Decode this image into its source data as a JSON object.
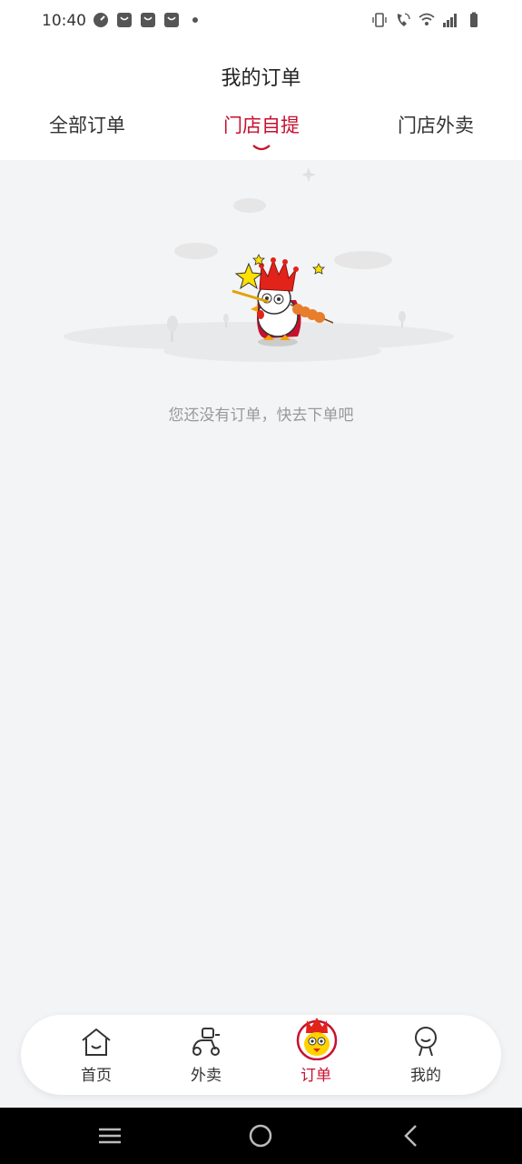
{
  "status_bar": {
    "time": "10:40",
    "left_icons": [
      "speed-icon",
      "shopping-bag-icon",
      "shopping-bag-icon",
      "shopping-bag-icon",
      "dot-icon"
    ],
    "right_icons": [
      "vibrate-icon",
      "wifi-call-icon",
      "wifi-icon",
      "signal-icon",
      "battery-icon"
    ]
  },
  "header": {
    "title": "我的订单",
    "tabs": [
      {
        "label": "全部订单",
        "active": false
      },
      {
        "label": "门店自提",
        "active": true
      },
      {
        "label": "门店外卖",
        "active": false
      }
    ]
  },
  "empty_state": {
    "message": "您还没有订单，快去下单吧"
  },
  "bottom_nav": {
    "items": [
      {
        "label": "首页",
        "icon": "home-icon",
        "active": false
      },
      {
        "label": "外卖",
        "icon": "scooter-icon",
        "active": false
      },
      {
        "label": "订单",
        "icon": "mascot-icon",
        "active": true
      },
      {
        "label": "我的",
        "icon": "profile-icon",
        "active": false
      }
    ]
  },
  "colors": {
    "accent": "#c8102e",
    "background": "#f3f4f6",
    "text_muted": "#999999"
  }
}
